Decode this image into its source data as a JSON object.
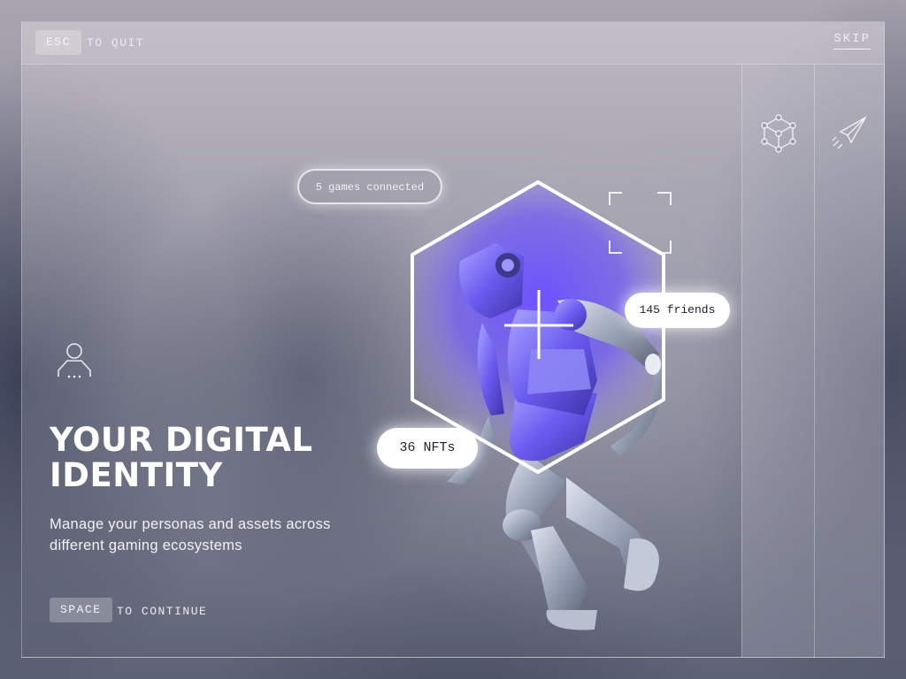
{
  "topbar": {
    "esc_key": "ESC",
    "esc_hint": "TO QUIT",
    "skip_label": "SKIP"
  },
  "side_panels": [
    {
      "icon": "cube-network-icon"
    },
    {
      "icon": "rocket-icon"
    }
  ],
  "hero": {
    "profile_icon": "person-icon",
    "title_line1": "YOUR DIGITAL",
    "title_line2": "IDENTITY",
    "subtitle": "Manage your personas and assets across different gaming ecosystems"
  },
  "badges": {
    "games": "5 games connected",
    "friends": "145 friends",
    "nfts": "36 NFTs"
  },
  "footer": {
    "space_key": "SPACE",
    "space_hint": "TO CONTINUE"
  },
  "colors": {
    "accent_glow": "#7b62ff",
    "hex_stroke": "#ffffff"
  }
}
